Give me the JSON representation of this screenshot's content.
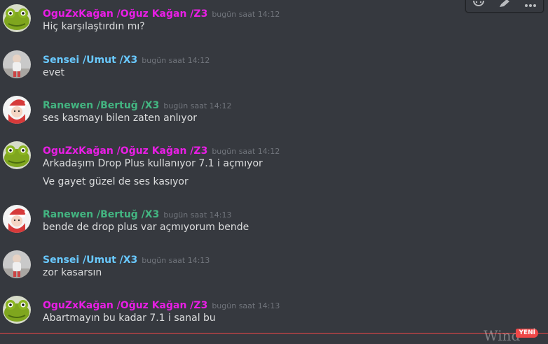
{
  "colors": {
    "pink": "#e91ee5",
    "cyan": "#69c9ff",
    "green": "#43b581",
    "timestamp": "#72767d",
    "text": "#dcddde",
    "background": "#36393f",
    "new_red": "#f04747"
  },
  "toolbar": {
    "reaction_icon": "add-reaction-icon",
    "edit_icon": "pencil-icon",
    "more_icon": "ellipsis-icon"
  },
  "messages": [
    {
      "username": "OguZxKağan /Oğuz Kağan /Z3",
      "color_key": "pink",
      "avatar": "green-frog-avatar",
      "timestamp": "bugün saat 14:12",
      "lines": [
        "Hiç karşılaştırdın mı?"
      ]
    },
    {
      "username": "Sensei /Umut /X3",
      "color_key": "cyan",
      "avatar": "child-photo-avatar",
      "timestamp": "bugün saat 14:12",
      "lines": [
        "evet"
      ]
    },
    {
      "username": "Ranewen /Bertuğ /X3",
      "color_key": "green",
      "avatar": "santa-avatar",
      "timestamp": "bugün saat 14:12",
      "lines": [
        "ses kasmayı bilen zaten anlıyor"
      ]
    },
    {
      "username": "OguZxKağan /Oğuz Kağan /Z3",
      "color_key": "pink",
      "avatar": "green-frog-avatar",
      "timestamp": "bugün saat 14:12",
      "lines": [
        "Arkadaşım Drop Plus kullanıyor 7.1 i açmıyor",
        "Ve gayet güzel de ses kasıyor"
      ]
    },
    {
      "username": "Ranewen /Bertuğ /X3",
      "color_key": "green",
      "avatar": "santa-avatar",
      "timestamp": "bugün saat 14:13",
      "lines": [
        "bende de drop plus var açmıyorum bende"
      ]
    },
    {
      "username": "Sensei /Umut /X3",
      "color_key": "cyan",
      "avatar": "child-photo-avatar",
      "timestamp": "bugün saat 14:13",
      "lines": [
        "zor kasarsın"
      ]
    },
    {
      "username": "OguZxKağan /Oğuz Kağan /Z3",
      "color_key": "pink",
      "avatar": "green-frog-avatar",
      "timestamp": "bugün saat 14:13",
      "lines": [
        "Abartmayın bu kadar 7.1 i sanal bu"
      ]
    }
  ],
  "new_badge": "YENİ",
  "watermark": "Wind"
}
